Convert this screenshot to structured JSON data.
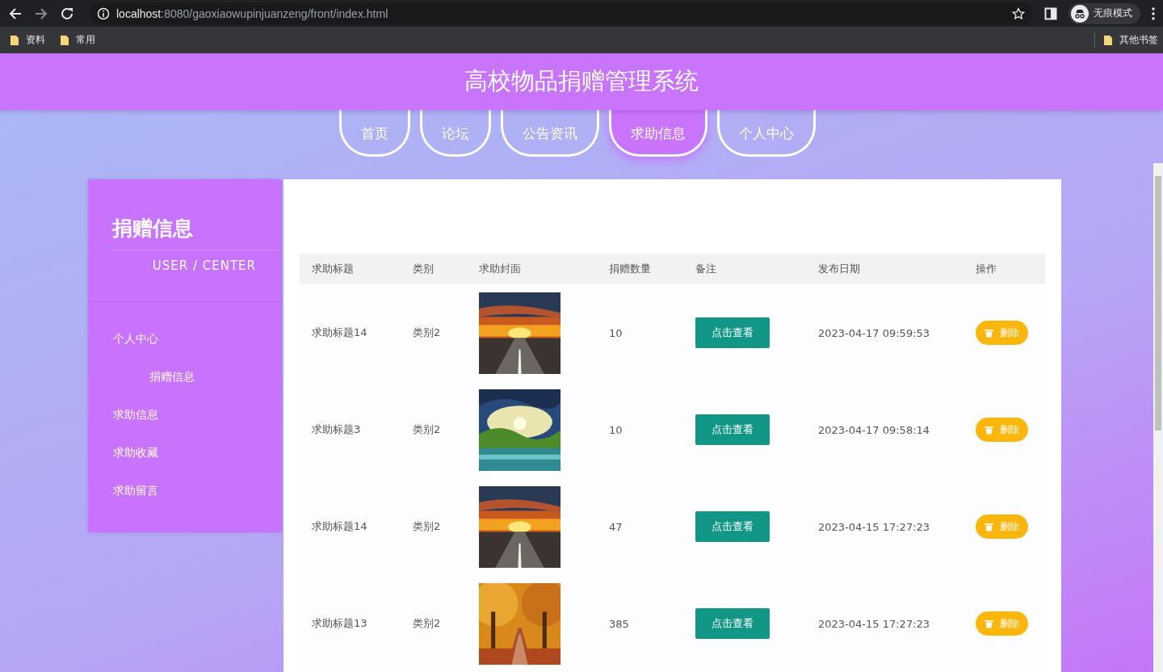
{
  "browser": {
    "url_host": "localhost",
    "url_path": ":8080/gaoxiaowupinjuanzeng/front/index.html",
    "profile": "无痕模式",
    "bookmarks": [
      "资料",
      "常用"
    ],
    "other_bookmarks": "其他书签"
  },
  "header": {
    "title": "高校物品捐赠管理系统"
  },
  "nav": [
    {
      "label": "首页",
      "selected": false
    },
    {
      "label": "论坛",
      "selected": false
    },
    {
      "label": "公告资讯",
      "selected": false
    },
    {
      "label": "求助信息",
      "selected": true
    },
    {
      "label": "个人中心",
      "selected": false
    }
  ],
  "sidebar": {
    "title": "捐赠信息",
    "subtitle": "USER / CENTER",
    "items": [
      {
        "label": "个人中心",
        "children": [
          {
            "label": "捐赠信息"
          }
        ]
      },
      {
        "label": "求助信息"
      },
      {
        "label": "求助收藏"
      },
      {
        "label": "求助留言"
      }
    ]
  },
  "table": {
    "columns": [
      "求助标题",
      "类别",
      "求助封面",
      "捐赠数量",
      "备注",
      "发布日期",
      "操作"
    ],
    "rows": [
      {
        "title": "求助标题14",
        "category": "类别2",
        "quantity": "10",
        "note_button": "点击查看",
        "date": "2023-04-17 09:59:53",
        "delete_button": "删除"
      },
      {
        "title": "求助标题3",
        "category": "类别2",
        "quantity": "10",
        "note_button": "点击查看",
        "date": "2023-04-17 09:58:14",
        "delete_button": "删除"
      },
      {
        "title": "求助标题14",
        "category": "类别2",
        "quantity": "47",
        "note_button": "点击查看",
        "date": "2023-04-15 17:27:23",
        "delete_button": "删除"
      },
      {
        "title": "求助标题13",
        "category": "类别2",
        "quantity": "385",
        "note_button": "点击查看",
        "date": "2023-04-15 17:27:23",
        "delete_button": "删除"
      }
    ]
  }
}
